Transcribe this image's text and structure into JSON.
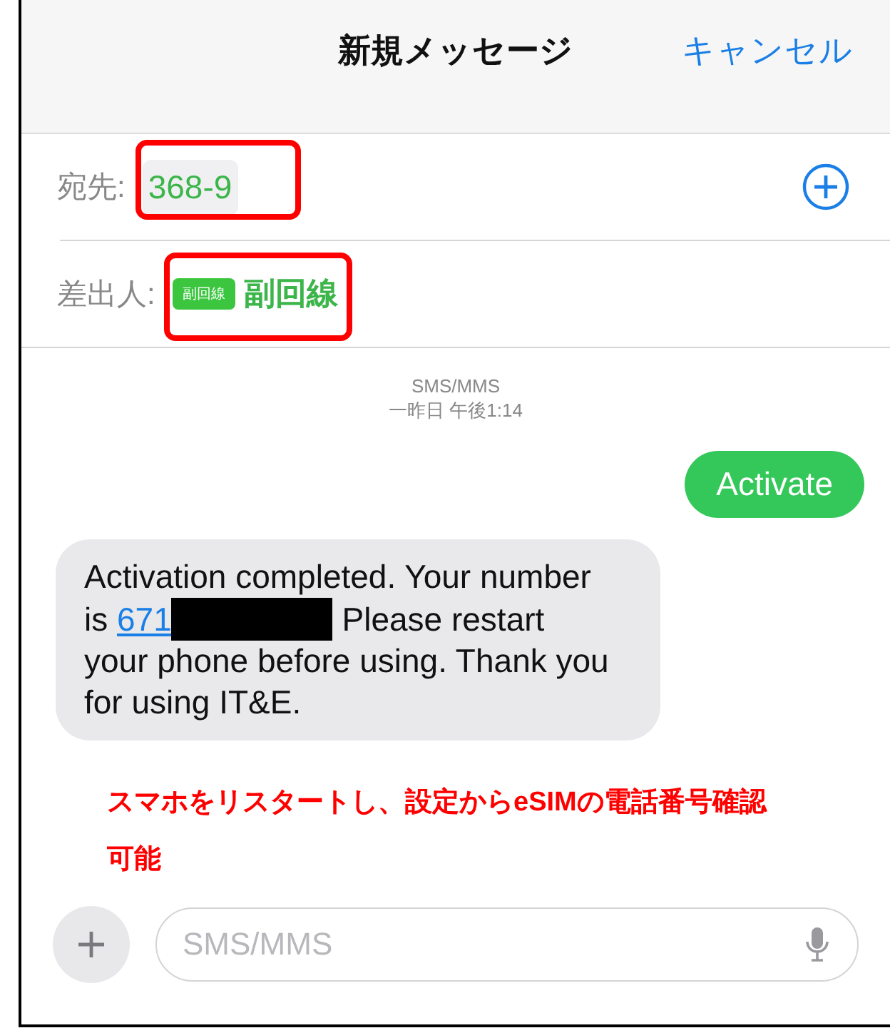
{
  "header": {
    "title": "新規メッセージ",
    "cancel": "キャンセル"
  },
  "to": {
    "label": "宛先:",
    "recipient": "368-9",
    "highlighted": true
  },
  "from": {
    "label": "差出人:",
    "badge": "副回線",
    "line_name": "副回線",
    "highlighted": true
  },
  "conversation": {
    "service": "SMS/MMS",
    "timestamp": "一昨日 午後1:14"
  },
  "messages": [
    {
      "kind": "sent",
      "text": "Activate"
    },
    {
      "kind": "received",
      "text_before": "Activation completed. Your number is ",
      "link": "671",
      "redacted": true,
      "text_after": " Please restart your phone before using. Thank you for using IT&E."
    }
  ],
  "annotation": "スマホをリスタートし、設定からeSIMの電話番号確認可能",
  "composer": {
    "placeholder": "SMS/MMS"
  }
}
